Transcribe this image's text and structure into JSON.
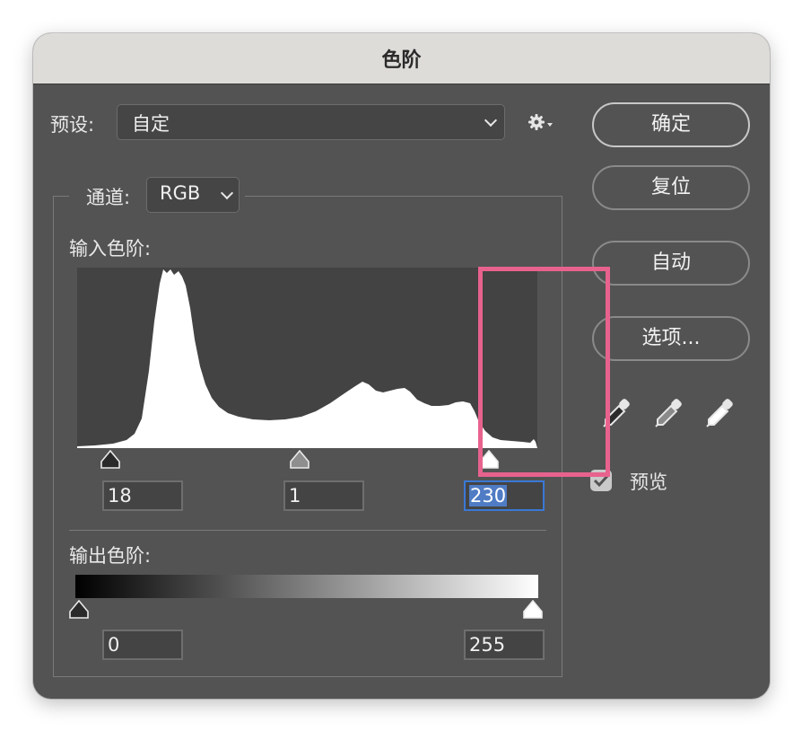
{
  "window": {
    "title": "色阶"
  },
  "preset": {
    "label": "预设:",
    "value": "自定"
  },
  "channel": {
    "label": "通道:",
    "value": "RGB"
  },
  "input_levels": {
    "label": "输入色阶:",
    "black": "18",
    "gamma": "1",
    "white": "230"
  },
  "output_levels": {
    "label": "输出色阶:",
    "black": "0",
    "white": "255"
  },
  "buttons": {
    "ok": "确定",
    "reset": "复位",
    "auto": "自动",
    "options": "选项..."
  },
  "preview": {
    "label": "预览",
    "checked": true
  },
  "icons": {
    "gear": "gear-icon",
    "black_point": "eyedropper-black-icon",
    "gray_point": "eyedropper-gray-icon",
    "white_point": "eyedropper-white-icon"
  },
  "colors": {
    "dialog_bg": "#535353",
    "titlebar_bg": "#dedcd9",
    "focus": "#3a78d6",
    "highlight": "#e8628e"
  }
}
